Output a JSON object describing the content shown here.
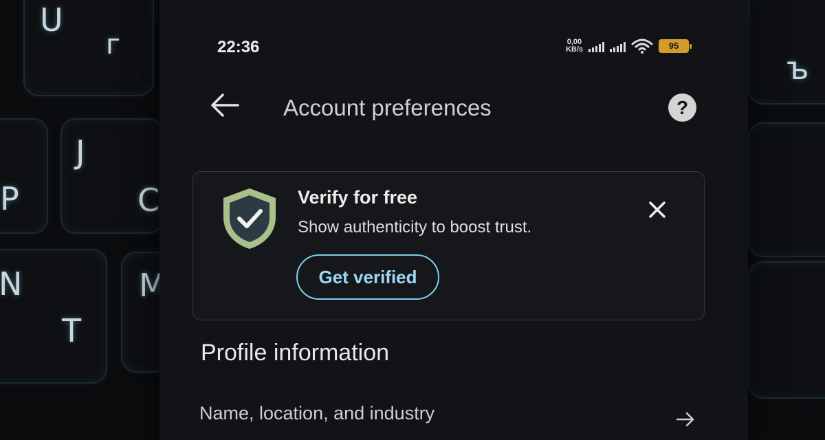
{
  "status_bar": {
    "time": "22:36",
    "network_speed_value": "0,00",
    "network_speed_unit": "KB/s",
    "battery": "95"
  },
  "header": {
    "title": "Account preferences",
    "help": "?"
  },
  "verify_card": {
    "title": "Verify for free",
    "subtitle": "Show authenticity to boost trust.",
    "button_label": "Get verified"
  },
  "profile_section": {
    "title": "Profile information",
    "items": [
      {
        "label": "Name, location, and industry"
      }
    ]
  },
  "keyboard_keys": [
    "U",
    "г",
    "J",
    "P",
    "C",
    "N",
    "T",
    "M",
    "ъ"
  ],
  "colors": {
    "accent": "#7fcdf0",
    "battery": "#d69a2a",
    "shield_outer": "#a9c08a",
    "shield_inner": "#2c3a44"
  }
}
